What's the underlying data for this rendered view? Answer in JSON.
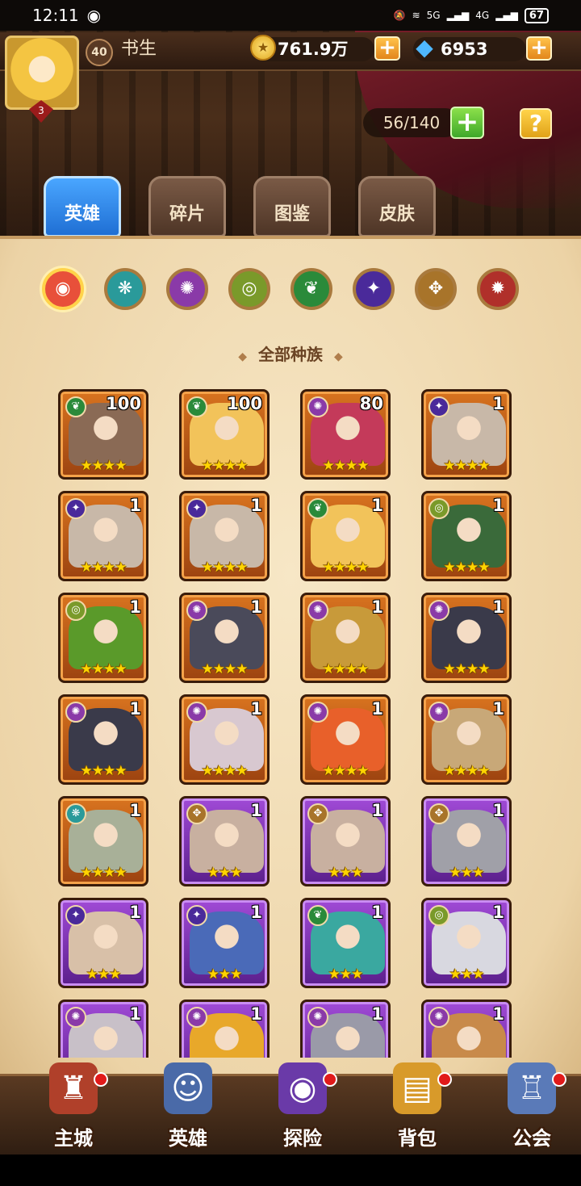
{
  "status_bar": {
    "time": "12:11",
    "battery": "67",
    "net1": "5G",
    "net2": "4G"
  },
  "player": {
    "level": "40",
    "name": "书生",
    "avatar_badge": "3"
  },
  "currency": {
    "gold": "761.9万",
    "gems": "6953"
  },
  "capacity": "56/140",
  "tabs": [
    {
      "label": "英雄",
      "active": true
    },
    {
      "label": "碎片",
      "active": false
    },
    {
      "label": "图鉴",
      "active": false
    },
    {
      "label": "皮肤",
      "active": false
    }
  ],
  "race_filters": [
    {
      "name": "all-races",
      "glyph": "◉",
      "color": "#e8503a",
      "selected": true
    },
    {
      "name": "race-1",
      "glyph": "❋",
      "color": "#2a9a9a",
      "selected": false
    },
    {
      "name": "race-2",
      "glyph": "✺",
      "color": "#8a3aa8",
      "selected": false
    },
    {
      "name": "race-3",
      "glyph": "◎",
      "color": "#7a9a2a",
      "selected": false
    },
    {
      "name": "race-4",
      "glyph": "❦",
      "color": "#2a8a3a",
      "selected": false
    },
    {
      "name": "race-5",
      "glyph": "✦",
      "color": "#4a2a9a",
      "selected": false
    },
    {
      "name": "race-6",
      "glyph": "✥",
      "color": "#a8742a",
      "selected": false
    },
    {
      "name": "race-7",
      "glyph": "✹",
      "color": "#b0302a",
      "selected": false
    }
  ],
  "race_title": "全部种族",
  "heroes": [
    {
      "level": "100",
      "stars": "★★★★",
      "frame": "orange",
      "race_color": "#2a8a3a",
      "race_glyph": "❦",
      "portrait": "#8a6a55"
    },
    {
      "level": "100",
      "stars": "★★★★",
      "frame": "orange",
      "race_color": "#2a8a3a",
      "race_glyph": "❦",
      "portrait": "#f2c35a"
    },
    {
      "level": "80",
      "stars": "★★★★",
      "frame": "orange",
      "race_color": "#8a3aa8",
      "race_glyph": "✺",
      "portrait": "#c43a5a"
    },
    {
      "level": "1",
      "stars": "★★★★",
      "frame": "orange",
      "race_color": "#4a2a9a",
      "race_glyph": "✦",
      "portrait": "#c8b8a8"
    },
    {
      "level": "1",
      "stars": "★★★★",
      "frame": "orange",
      "race_color": "#4a2a9a",
      "race_glyph": "✦",
      "portrait": "#c8b8a8"
    },
    {
      "level": "1",
      "stars": "★★★★",
      "frame": "orange",
      "race_color": "#4a2a9a",
      "race_glyph": "✦",
      "portrait": "#c8b8a8"
    },
    {
      "level": "1",
      "stars": "★★★★",
      "frame": "orange",
      "race_color": "#2a8a3a",
      "race_glyph": "❦",
      "portrait": "#f2c35a"
    },
    {
      "level": "1",
      "stars": "★★★★",
      "frame": "orange",
      "race_color": "#7a9a2a",
      "race_glyph": "◎",
      "portrait": "#3a6a3a"
    },
    {
      "level": "1",
      "stars": "★★★★",
      "frame": "orange",
      "race_color": "#7a9a2a",
      "race_glyph": "◎",
      "portrait": "#5a9a2a"
    },
    {
      "level": "1",
      "stars": "★★★★",
      "frame": "orange",
      "race_color": "#8a3aa8",
      "race_glyph": "✺",
      "portrait": "#4a4a5a"
    },
    {
      "level": "1",
      "stars": "★★★★",
      "frame": "orange",
      "race_color": "#8a3aa8",
      "race_glyph": "✺",
      "portrait": "#c89a3a"
    },
    {
      "level": "1",
      "stars": "★★★★",
      "frame": "orange",
      "race_color": "#8a3aa8",
      "race_glyph": "✺",
      "portrait": "#3a3a4a"
    },
    {
      "level": "1",
      "stars": "★★★★",
      "frame": "orange",
      "race_color": "#8a3aa8",
      "race_glyph": "✺",
      "portrait": "#3a3a4a"
    },
    {
      "level": "1",
      "stars": "★★★★",
      "frame": "orange",
      "race_color": "#8a3aa8",
      "race_glyph": "✺",
      "portrait": "#d8c8d0"
    },
    {
      "level": "1",
      "stars": "★★★★",
      "frame": "orange",
      "race_color": "#8a3aa8",
      "race_glyph": "✺",
      "portrait": "#e8602a"
    },
    {
      "level": "1",
      "stars": "★★★★",
      "frame": "orange",
      "race_color": "#8a3aa8",
      "race_glyph": "✺",
      "portrait": "#c8a878"
    },
    {
      "level": "1",
      "stars": "★★★★",
      "frame": "orange",
      "race_color": "#2a9a9a",
      "race_glyph": "❋",
      "portrait": "#a8b098"
    },
    {
      "level": "1",
      "stars": "★★★",
      "frame": "purple",
      "race_color": "#a8742a",
      "race_glyph": "✥",
      "portrait": "#c8b0a0"
    },
    {
      "level": "1",
      "stars": "★★★",
      "frame": "purple",
      "race_color": "#a8742a",
      "race_glyph": "✥",
      "portrait": "#c8b0a0"
    },
    {
      "level": "1",
      "stars": "★★★",
      "frame": "purple",
      "race_color": "#a8742a",
      "race_glyph": "✥",
      "portrait": "#a0a0a8"
    },
    {
      "level": "1",
      "stars": "★★★",
      "frame": "purple",
      "race_color": "#4a2a9a",
      "race_glyph": "✦",
      "portrait": "#d8c0a8"
    },
    {
      "level": "1",
      "stars": "★★★",
      "frame": "purple",
      "race_color": "#4a2a9a",
      "race_glyph": "✦",
      "portrait": "#4a6ab8"
    },
    {
      "level": "1",
      "stars": "★★★",
      "frame": "purple",
      "race_color": "#2a8a3a",
      "race_glyph": "❦",
      "portrait": "#3aa8a0"
    },
    {
      "level": "1",
      "stars": "★★★",
      "frame": "purple",
      "race_color": "#7a9a2a",
      "race_glyph": "◎",
      "portrait": "#d8d8e0"
    },
    {
      "level": "1",
      "stars": "",
      "frame": "purple",
      "race_color": "#8a3aa8",
      "race_glyph": "✺",
      "portrait": "#c8c0c8"
    },
    {
      "level": "1",
      "stars": "",
      "frame": "purple",
      "race_color": "#8a3aa8",
      "race_glyph": "✺",
      "portrait": "#e8a82a"
    },
    {
      "level": "1",
      "stars": "",
      "frame": "purple",
      "race_color": "#8a3aa8",
      "race_glyph": "✺",
      "portrait": "#9a9aa8"
    },
    {
      "level": "1",
      "stars": "",
      "frame": "purple",
      "race_color": "#8a3aa8",
      "race_glyph": "✺",
      "portrait": "#c88a4a"
    }
  ],
  "nav": [
    {
      "label": "主城",
      "icon": "♜",
      "color": "#b0402a",
      "dot": true
    },
    {
      "label": "英雄",
      "icon": "☺",
      "color": "#4a6aa8",
      "dot": false
    },
    {
      "label": "探险",
      "icon": "◉",
      "color": "#6a3aa8",
      "dot": true
    },
    {
      "label": "背包",
      "icon": "▤",
      "color": "#d89a2a",
      "dot": true
    },
    {
      "label": "公会",
      "icon": "♖",
      "color": "#5a7ab8",
      "dot": true
    }
  ]
}
